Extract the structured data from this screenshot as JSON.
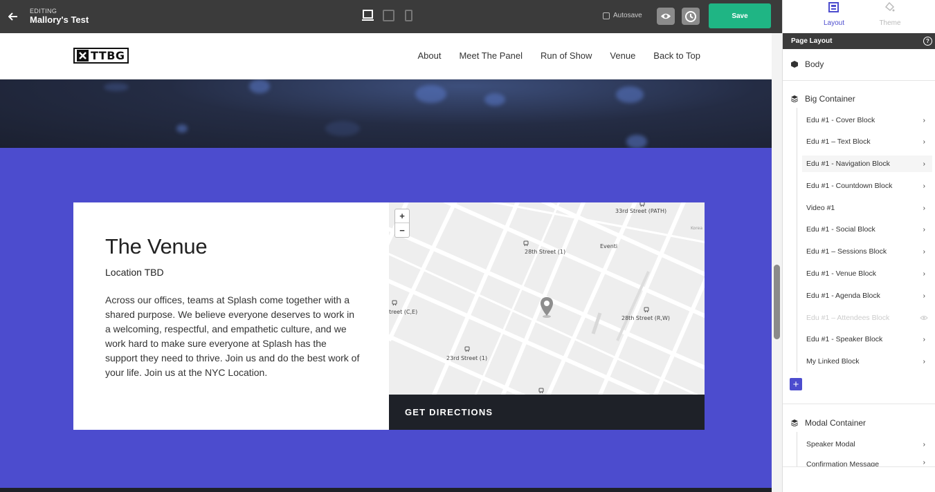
{
  "editor": {
    "status_label": "EDITING",
    "page_name": "Mallory's Test",
    "autosave_label": "Autosave",
    "save_label": "Save"
  },
  "site": {
    "logo_text": "TTBG",
    "nav": [
      "About",
      "Meet The Panel",
      "Run of Show",
      "Venue",
      "Back to Top"
    ]
  },
  "venue": {
    "title": "The Venue",
    "subtitle": "Location TBD",
    "body": "Across our offices, teams at Splash come together with a shared purpose. We believe everyone deserves to work in a welcoming, respectful, and empathetic culture, and we work hard to make sure everyone at Splash has the support they need to thrive. Join us and do the best work of your life. Join us at the NYC Location.",
    "directions_label": "GET DIRECTIONS",
    "map_labels": {
      "station_1": "33rd Street (PATH)",
      "station_2": "28th Street (1)",
      "station_3": "treet (C,E)",
      "station_4": "28th Street (R,W)",
      "station_5": "23rd Street (1)",
      "poi": "Eventi",
      "korea": "Korea"
    },
    "map_zoom_in": "+",
    "map_zoom_out": "−"
  },
  "panel": {
    "tabs": [
      {
        "label": "Layout",
        "active": true
      },
      {
        "label": "Theme",
        "active": false
      }
    ],
    "header": "Page Layout",
    "help": "?",
    "body_label": "Body",
    "big_container_label": "Big Container",
    "blocks": [
      {
        "label": "Edu #1 - Cover Block",
        "state": "normal"
      },
      {
        "label": "Edu #1 – Text Block",
        "state": "normal"
      },
      {
        "label": "Edu #1 - Navigation Block",
        "state": "active"
      },
      {
        "label": "Edu #1 - Countdown Block",
        "state": "normal"
      },
      {
        "label": "Video #1",
        "state": "normal"
      },
      {
        "label": "Edu #1 - Social Block",
        "state": "normal"
      },
      {
        "label": "Edu #1 – Sessions Block",
        "state": "normal"
      },
      {
        "label": "Edu #1 - Venue Block",
        "state": "normal"
      },
      {
        "label": "Edu #1 - Agenda Block",
        "state": "normal"
      },
      {
        "label": "Edu #1 – Attendees Block",
        "state": "hidden"
      },
      {
        "label": "Edu #1 - Speaker Block",
        "state": "normal"
      },
      {
        "label": "My Linked Block",
        "state": "normal"
      }
    ],
    "modal_container_label": "Modal Container",
    "modal_items": [
      {
        "label": "Speaker Modal"
      },
      {
        "label": "Confirmation Message"
      }
    ]
  },
  "colors": {
    "accent": "#4c4cce",
    "save": "#1fb584",
    "toolbar": "#3b3b3b",
    "dark_button": "#1e2128"
  }
}
